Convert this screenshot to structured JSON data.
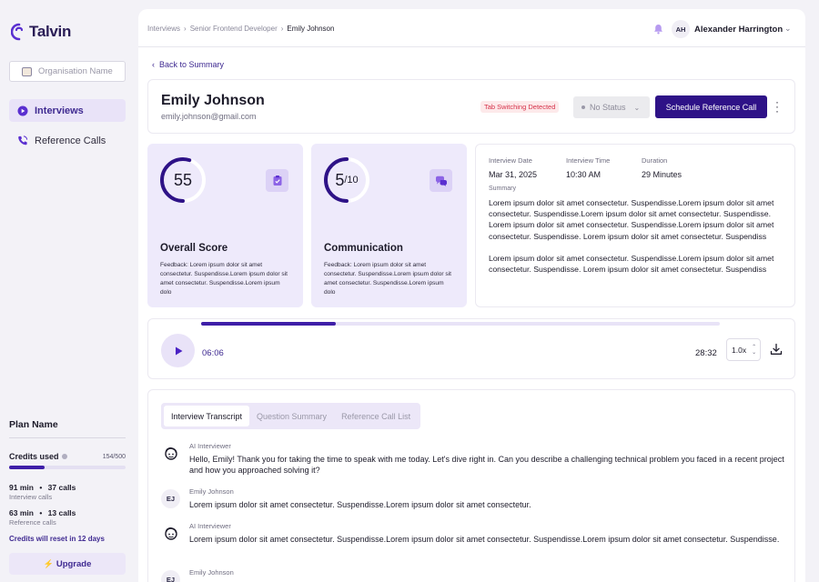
{
  "brand": {
    "name": "Talvin"
  },
  "sidebar": {
    "org_placeholder": "Organisation Name",
    "nav": [
      {
        "label": "Interviews",
        "active": true
      },
      {
        "label": "Reference Calls",
        "active": false
      }
    ],
    "plan": {
      "title": "Plan Name",
      "credits_label": "Credits used",
      "credits_value": "154/500",
      "credits_fraction": 0.308,
      "interview_minutes": "91 min",
      "interview_calls": "37 calls",
      "interview_label": "Interview calls",
      "reference_minutes": "63 min",
      "reference_calls": "13 calls",
      "reference_label": "Reference calls",
      "reset_note": "Credits will reset in 12 days",
      "upgrade_label": "Upgrade"
    }
  },
  "topbar": {
    "breadcrumbs": [
      "Interviews",
      "Senior Frontend Developer",
      "Emily Johnson"
    ],
    "user_initials": "AH",
    "user_name": "Alexander Harrington"
  },
  "back_label": "Back to Summary",
  "candidate": {
    "name": "Emily Johnson",
    "email": "emily.johnson@gmail.com",
    "flag": "Tab Switching Detected",
    "status": "No Status",
    "schedule_label": "Schedule Reference Call"
  },
  "scores": [
    {
      "value": "55",
      "suffix": "",
      "fraction": 0.55,
      "title": "Overall Score",
      "feedback": "Feedback: Lorem ipsum dolor sit amet consectetur. Suspendisse.Lorem ipsum dolor sit amet consectetur. Suspendisse.Lorem ipsum dolo",
      "icon": "clipboard-check-icon"
    },
    {
      "value": "5",
      "suffix": "/10",
      "fraction": 0.5,
      "title": "Communication",
      "feedback": "Feedback: Lorem ipsum dolor sit amet consectetur. Suspendisse.Lorem ipsum dolor sit amet consectetur. Suspendisse.Lorem ipsum dolo",
      "icon": "chat-bubbles-icon"
    }
  ],
  "details": {
    "date_label": "Interview Date",
    "date_value": "Mar 31, 2025",
    "time_label": "Interview Time",
    "time_value": "10:30 AM",
    "duration_label": "Duration",
    "duration_value": "29 Minutes",
    "summary_label": "Summary",
    "summary_p1": "Lorem ipsum dolor sit amet consectetur. Suspendisse.Lorem ipsum dolor sit amet consectetur. Suspendisse.Lorem ipsum dolor sit amet consectetur. Suspendisse. Lorem ipsum dolor sit amet consectetur. Suspendisse.Lorem ipsum dolor sit amet consectetur. Suspendisse. Lorem ipsum dolor sit amet consectetur. Suspendiss",
    "summary_p2": "Lorem ipsum dolor sit amet consectetur. Suspendisse.Lorem ipsum dolor sit amet consectetur. Suspendisse. Lorem ipsum dolor sit amet consectetur. Suspendiss"
  },
  "player": {
    "current": "06:06",
    "total": "28:32",
    "progress_fraction": 0.26,
    "speed": "1.0x"
  },
  "transcript": {
    "tabs": [
      {
        "label": "Interview Transcript",
        "active": true
      },
      {
        "label": "Question Summary",
        "active": false
      },
      {
        "label": "Reference Call List",
        "active": false
      }
    ],
    "messages": [
      {
        "speaker": "AI Interviewer",
        "avatar": "",
        "ai": true,
        "text": "Hello, Emily! Thank you for taking the time to speak with me today. Let's dive right in. Can you describe a challenging technical problem you faced in a recent project and how you approached solving it?"
      },
      {
        "speaker": "Emily Johnson",
        "avatar": "EJ",
        "ai": false,
        "text": "Lorem ipsum dolor sit amet consectetur. Suspendisse.Lorem ipsum dolor sit amet consectetur."
      },
      {
        "speaker": "AI Interviewer",
        "avatar": "",
        "ai": true,
        "text": "Lorem ipsum dolor sit amet consectetur. Suspendisse.Lorem ipsum dolor sit amet consectetur. Suspendisse.Lorem ipsum dolor sit amet consectetur. Suspendisse."
      },
      {
        "speaker": "Emily Johnson",
        "avatar": "EJ",
        "ai": false,
        "text": ""
      }
    ]
  },
  "colors": {
    "accent": "#3f1fa8",
    "accent_dark": "#2e1287",
    "accent_soft": "#eeeafb",
    "danger": "#d6324a"
  }
}
